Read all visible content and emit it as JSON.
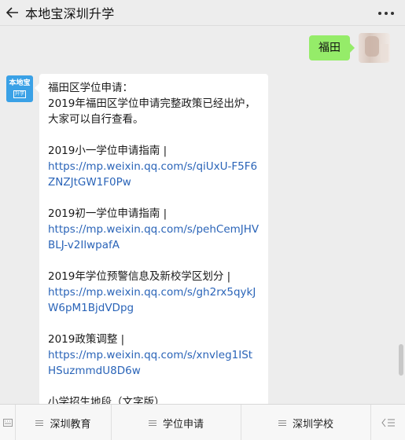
{
  "header": {
    "title": "本地宝深圳升学"
  },
  "chat": {
    "outgoing": {
      "text": "福田"
    },
    "bot_avatar": {
      "line1": "本地宝",
      "line2": "升学"
    },
    "incoming": {
      "intro_lines": [
        "福田区学位申请：",
        "2019年福田区学位申请完整政策已经出炉，",
        "大家可以自行查看。"
      ],
      "items": [
        {
          "label": "2019小一学位申请指南 |",
          "url": "https://mp.weixin.qq.com/s/qiUxU-F5F6ZNZJtGW1F0Pw"
        },
        {
          "label": "2019初一学位申请指南 |",
          "url": "https://mp.weixin.qq.com/s/pehCemJHVBLJ-v2IlwpafA"
        },
        {
          "label": "2019年学位预警信息及新校学区划分 |",
          "url": "https://mp.weixin.qq.com/s/gh2rx5qykJW6pM1BjdVDpg"
        },
        {
          "label": "2019政策调整 |",
          "url": "https://mp.weixin.qq.com/s/xnvleg1IStHSuzmmdU8D6w"
        }
      ],
      "trailing": "小学招生地段（文字版）"
    }
  },
  "bottom_menu": {
    "tabs": [
      "深圳教育",
      "学位申请",
      "深圳学校"
    ]
  }
}
